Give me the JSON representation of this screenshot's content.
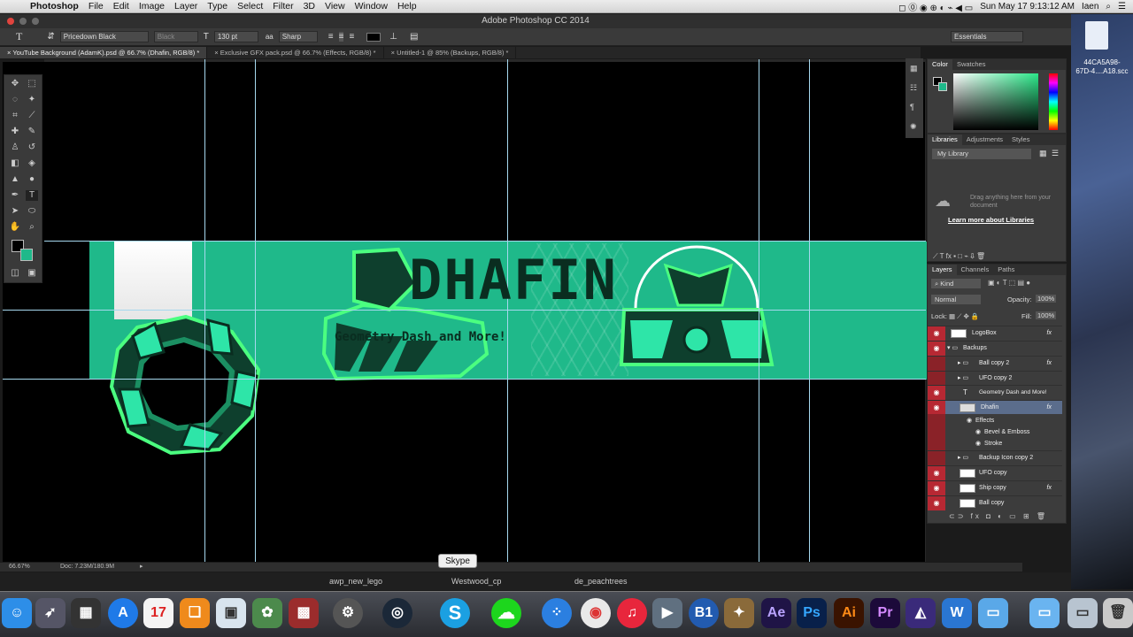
{
  "menubar": {
    "apple": "",
    "app": "Photoshop",
    "items": [
      "File",
      "Edit",
      "Image",
      "Layer",
      "Type",
      "Select",
      "Filter",
      "3D",
      "View",
      "Window",
      "Help"
    ],
    "clock": "Sun May 17  9:13:12 AM",
    "user": "Iaen"
  },
  "window": {
    "title": "Adobe Photoshop CC 2014"
  },
  "options": {
    "tool_glyph": "T",
    "font_family": "Pricedown Black",
    "font_style": "Black",
    "font_size": "130 pt",
    "aa_label": "aa",
    "antialias": "Sharp",
    "workspace": "Essentials"
  },
  "tabs": [
    "YouTube Background (AdamK).psd @ 66.7% (Dhafin, RGB/8) *",
    "Exclusive GFX pack.psd @ 66.7% (Effects, RGB/8) *",
    "Untitled-1 @ 85% (Backups, RGB/8) *"
  ],
  "artwork": {
    "title": "Dhafin",
    "subtitle": "Geometry Dash and More!"
  },
  "status": {
    "zoom": "66.67%",
    "doc": "Doc: 7.23M/180.9M"
  },
  "color_panel": {
    "tabs": [
      "Color",
      "Swatches"
    ]
  },
  "libraries_panel": {
    "tabs": [
      "Libraries",
      "Adjustments",
      "Styles"
    ],
    "library": "My Library",
    "hint": "Drag anything here from your document",
    "link": "Learn more about Libraries"
  },
  "layers_panel": {
    "tabs": [
      "Layers",
      "Channels",
      "Paths"
    ],
    "kind": "Kind",
    "blend": "Normal",
    "opacity_label": "Opacity:",
    "opacity": "100%",
    "lock_label": "Lock:",
    "fill_label": "Fill:",
    "fill": "100%",
    "layers": [
      {
        "name": "LogoBox",
        "fx": "fx"
      },
      {
        "name": "Backups",
        "fx": ""
      },
      {
        "name": "Ball copy 2",
        "fx": "fx"
      },
      {
        "name": "UFO copy 2",
        "fx": ""
      },
      {
        "name": "Geometry Dash and More!",
        "fx": ""
      },
      {
        "name": "Dhafin",
        "fx": "fx"
      },
      {
        "name": "Effects",
        "fx": ""
      },
      {
        "name": "Bevel & Emboss",
        "fx": ""
      },
      {
        "name": "Stroke",
        "fx": ""
      },
      {
        "name": "Backup Icon copy 2",
        "fx": ""
      },
      {
        "name": "UFO copy",
        "fx": ""
      },
      {
        "name": "Ship copy",
        "fx": "fx"
      },
      {
        "name": "Ball copy",
        "fx": ""
      }
    ]
  },
  "desktop": {
    "file_label": "44CA5A98-\n67D-4....A18.scc"
  },
  "dock": {
    "tooltip": "Skype",
    "labels": [
      "awp_new_lego",
      "Westwood_cp",
      "de_peachtrees"
    ],
    "icons": [
      "Ae",
      "Ps",
      "Ai",
      "Pr",
      "B1"
    ]
  },
  "colors": {
    "banner": "#1fb98a",
    "accent": "#2ee5a8"
  }
}
